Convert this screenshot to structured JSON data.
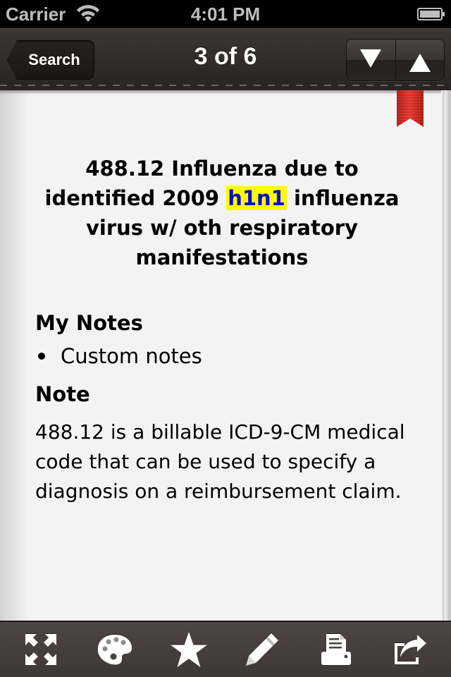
{
  "status_bar": {
    "carrier": "Carrier",
    "time": "4:01 PM",
    "wifi_icon": "wifi-icon",
    "battery_icon": "battery-full-icon"
  },
  "nav_bar": {
    "back_label": "Search",
    "title": "3 of 6",
    "next_icon": "triangle-down-icon",
    "prev_icon": "triangle-up-icon"
  },
  "page": {
    "bookmark_icon": "bookmark-ribbon-icon",
    "bookmark_color": "#d7281e",
    "title_before": "488.12 Influenza due to identified 2009 ",
    "title_highlight": "h1n1",
    "title_after": " influenza virus w/ oth respiratory manifestations",
    "highlight_bg": "#fcfc00",
    "highlight_fg": "#0a10c8",
    "my_notes_heading": "My Notes",
    "my_notes_items": [
      "Custom notes"
    ],
    "note_heading": "Note",
    "note_body": "488.12 is a billable ICD-9-CM medical code that can be used to specify a diagnosis on a reimbursement claim."
  },
  "toolbar": {
    "items": [
      {
        "name": "fullscreen",
        "icon": "expand-arrows-icon"
      },
      {
        "name": "theme",
        "icon": "palette-icon"
      },
      {
        "name": "favorite",
        "icon": "star-icon"
      },
      {
        "name": "edit-note",
        "icon": "pencil-icon"
      },
      {
        "name": "print",
        "icon": "printer-icon"
      },
      {
        "name": "share",
        "icon": "share-icon"
      }
    ]
  }
}
